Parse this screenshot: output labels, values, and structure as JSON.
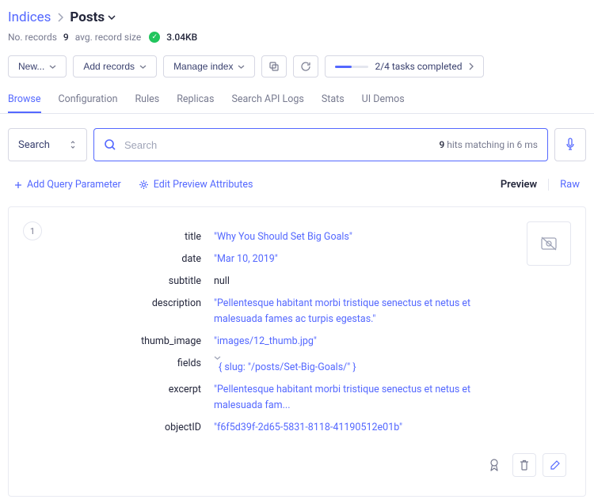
{
  "breadcrumb": {
    "parent": "Indices",
    "current": "Posts"
  },
  "stats": {
    "records_label": "No. records",
    "records_value": "9",
    "avg_label": "avg. record size",
    "size_value": "3.04KB"
  },
  "toolbar": {
    "new_btn": "New...",
    "add_records": "Add records",
    "manage_index": "Manage index",
    "progress_text": "2/4 tasks completed"
  },
  "tabs": [
    "Browse",
    "Configuration",
    "Rules",
    "Replicas",
    "Search API Logs",
    "Stats",
    "UI Demos"
  ],
  "active_tab": "Browse",
  "search": {
    "mode_label": "Search",
    "placeholder": "Search",
    "hits_count": "9",
    "hits_suffix": "hits matching in 6 ms"
  },
  "sub_toolbar": {
    "add_query_param": "Add Query Parameter",
    "edit_preview": "Edit Preview Attributes",
    "preview": "Preview",
    "raw": "Raw"
  },
  "record": {
    "index": "1",
    "attrs": [
      {
        "key": "title",
        "value": "\"Why You Should Set Big Goals\"",
        "type": "string"
      },
      {
        "key": "date",
        "value": "\"Mar 10, 2019\"",
        "type": "string"
      },
      {
        "key": "subtitle",
        "value": "null",
        "type": "null"
      },
      {
        "key": "description",
        "value": "\"Pellentesque habitant morbi tristique senectus et netus et malesuada fames ac turpis egestas.\"",
        "type": "string"
      },
      {
        "key": "thumb_image",
        "value": "\"images/12_thumb.jpg\"",
        "type": "string"
      },
      {
        "key": "fields",
        "value": "{ slug: \"/posts/Set-Big-Goals/\" }",
        "type": "object"
      },
      {
        "key": "excerpt",
        "value": "\"Pellentesque habitant morbi tristique senectus et netus et malesuada fam...",
        "type": "string"
      },
      {
        "key": "objectID",
        "value": "\"f6f5d39f-2d65-5831-8118-41190512e01b\"",
        "type": "string"
      }
    ]
  }
}
